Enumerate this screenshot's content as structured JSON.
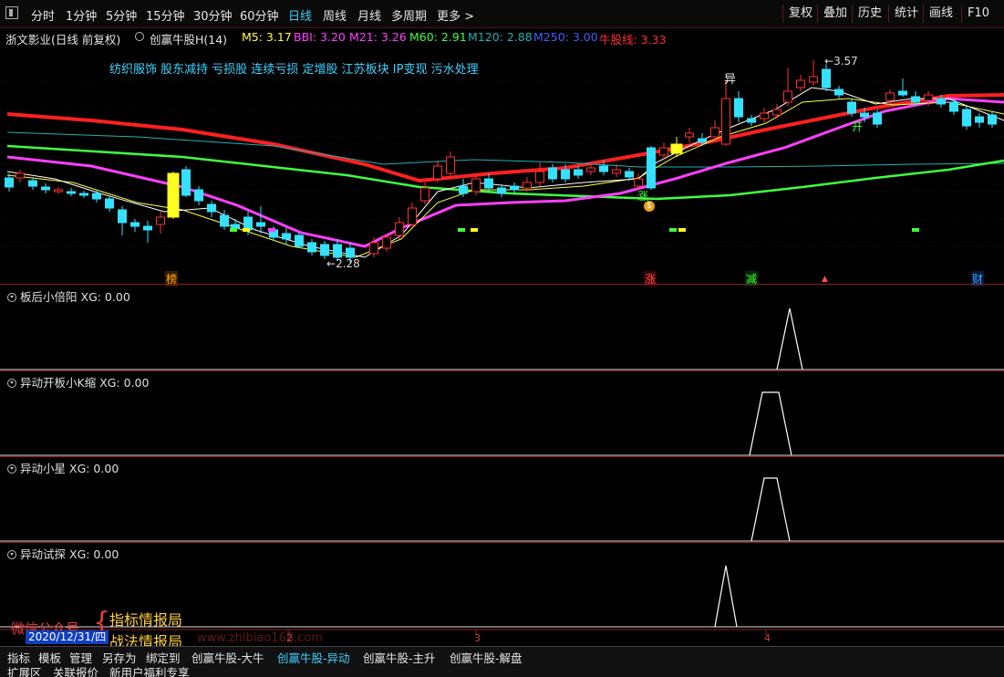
{
  "toolbar": {
    "periods": [
      "分时",
      "1分钟",
      "5分钟",
      "15分钟",
      "30分钟",
      "60分钟",
      "日线",
      "周线",
      "月线",
      "多周期",
      "更多 >"
    ],
    "active_period": "日线",
    "right_buttons": [
      "复权",
      "叠加",
      "历史",
      "统计",
      "画线",
      "F10"
    ]
  },
  "legend": {
    "stock": "浙文影业(日线 前复权)",
    "indicator": "创赢牛股H(14)",
    "m5": "M5: 3.17",
    "bbi": "BBI: 3.20",
    "m21": "M21: 3.26",
    "m60": "M60: 2.91",
    "m120": "M120: 2.88",
    "m250": "M250: 3.00",
    "niu": "牛股线: 3.33"
  },
  "concepts": "纺织服饰 股东减持 亏损股 连续亏损 定增股 江苏板块 IP变现 污水处理",
  "annotations": {
    "high_price": "3.57",
    "low_price": "2.28",
    "yi_mark": "异",
    "kai_mark": "开",
    "zhang_mark": "涨",
    "event_bang": "榜",
    "event_zhang": "涨",
    "event_jian": "减",
    "event_cai": "财"
  },
  "panes": [
    {
      "name": "板后小倍阳",
      "xg": "XG: 0.00"
    },
    {
      "name": "异动开板小K缩",
      "xg": "XG: 0.00"
    },
    {
      "name": "异动小星",
      "xg": "XG: 0.00"
    },
    {
      "name": "异动试探",
      "xg": "XG: 0.00"
    }
  ],
  "date_box": "2020/12/31/四",
  "axis_ticks": [
    "2",
    "3",
    "4"
  ],
  "watermark": {
    "wechat": "微信公众号",
    "brace": "{",
    "line1": "指标情报局",
    "line2": "战法情报局",
    "url": "www.zhibiao168.com"
  },
  "bottom_tabs": [
    "指标",
    "模板",
    "管理",
    "另存为",
    "绑定到",
    "创赢牛股-大牛",
    "创赢牛股-异动",
    "创赢牛股-主升",
    "创赢牛股-解盘"
  ],
  "active_bottom_tab": "创赢牛股-异动",
  "bottom_tabs2": [
    "扩展区",
    "关联报价",
    "新用户福利专享"
  ],
  "colors": {
    "up": "#ff3030",
    "down": "#36e0ff",
    "m5": "#ffffff",
    "bbi": "#ffff40",
    "m21": "#ff40ff",
    "m60": "#40ff40",
    "m120": "#20b0b0",
    "m250": "#4040ff",
    "niu": "#ff2020"
  }
}
